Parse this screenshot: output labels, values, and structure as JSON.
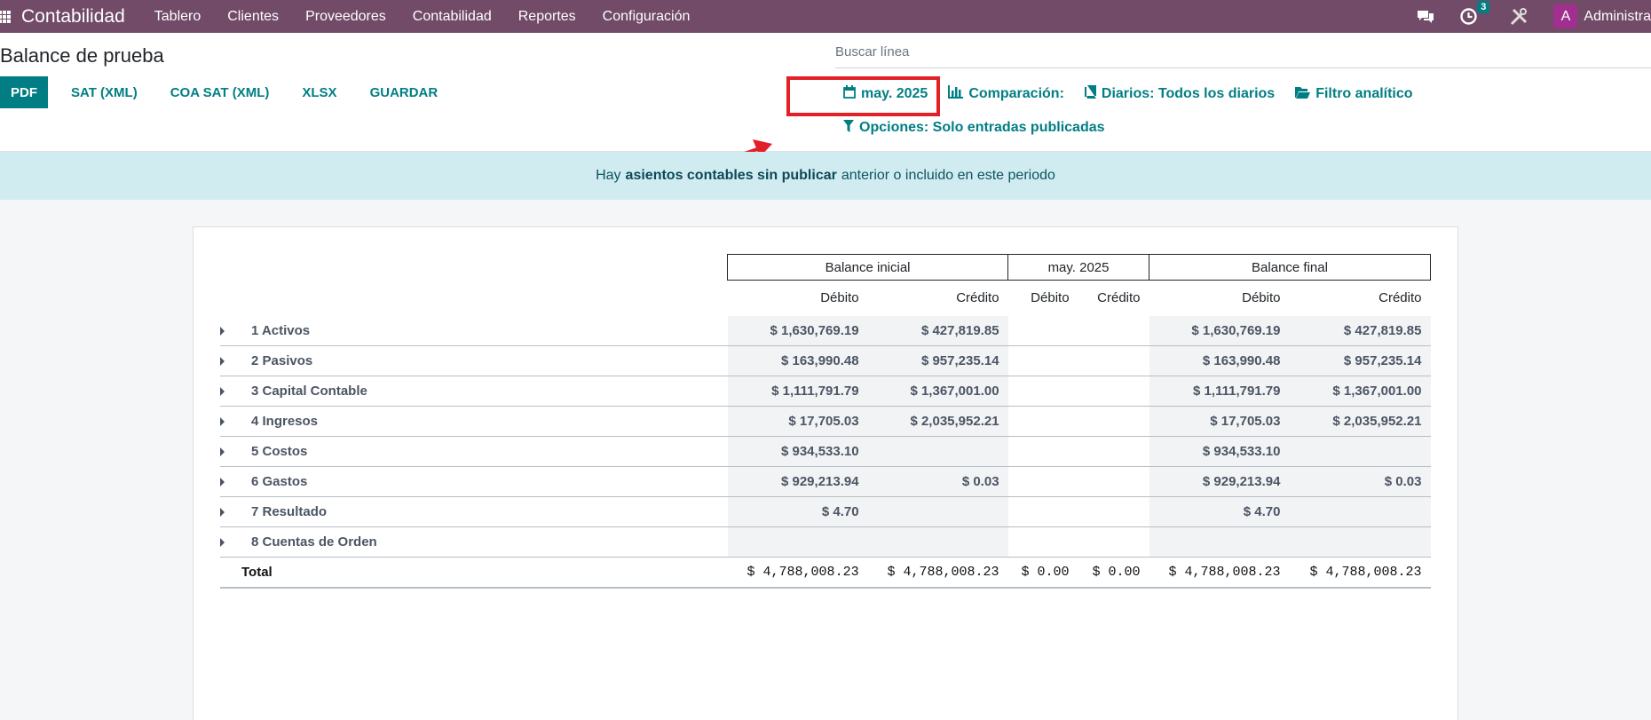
{
  "navbar": {
    "brand": "Contabilidad",
    "items": [
      "Tablero",
      "Clientes",
      "Proveedores",
      "Contabilidad",
      "Reportes",
      "Configuración"
    ],
    "activity_badge": "3",
    "avatar_letter": "A",
    "user": "Administra"
  },
  "control": {
    "title": "Balance de prueba",
    "search_placeholder": "Buscar línea",
    "buttons": {
      "pdf": "PDF",
      "sat_xml": "SAT (XML)",
      "coa_sat_xml": "COA SAT (XML)",
      "xlsx": "XLSX",
      "save": "GUARDAR"
    },
    "filters": {
      "period": "may. 2025",
      "comparison": "Comparación:",
      "journals": "Diarios: Todos los diarios",
      "analytic": "Filtro analítico",
      "options": "Opciones: Solo entradas publicadas"
    }
  },
  "alert": {
    "prefix": "Hay",
    "link": "asientos contables sin publicar",
    "suffix": "anterior o incluido en este periodo"
  },
  "report": {
    "groups": [
      "Balance inicial",
      "may. 2025",
      "Balance final"
    ],
    "subcols": [
      "Débito",
      "Crédito",
      "Débito",
      "Crédito",
      "Débito",
      "Crédito"
    ],
    "rows": [
      {
        "name": "1 Activos",
        "v": [
          "$ 1,630,769.19",
          "$ 427,819.85",
          "",
          "",
          "$ 1,630,769.19",
          "$ 427,819.85"
        ]
      },
      {
        "name": "2 Pasivos",
        "v": [
          "$ 163,990.48",
          "$ 957,235.14",
          "",
          "",
          "$ 163,990.48",
          "$ 957,235.14"
        ]
      },
      {
        "name": "3 Capital Contable",
        "v": [
          "$ 1,111,791.79",
          "$ 1,367,001.00",
          "",
          "",
          "$ 1,111,791.79",
          "$ 1,367,001.00"
        ]
      },
      {
        "name": "4 Ingresos",
        "v": [
          "$ 17,705.03",
          "$ 2,035,952.21",
          "",
          "",
          "$ 17,705.03",
          "$ 2,035,952.21"
        ]
      },
      {
        "name": "5 Costos",
        "v": [
          "$ 934,533.10",
          "",
          "",
          "",
          "$ 934,533.10",
          ""
        ]
      },
      {
        "name": "6 Gastos",
        "v": [
          "$ 929,213.94",
          "$ 0.03",
          "",
          "",
          "$ 929,213.94",
          "$ 0.03"
        ]
      },
      {
        "name": "7 Resultado",
        "v": [
          "$ 4.70",
          "",
          "",
          "",
          "$ 4.70",
          ""
        ]
      },
      {
        "name": "8 Cuentas de Orden",
        "v": [
          "",
          "",
          "",
          "",
          "",
          ""
        ]
      }
    ],
    "total": {
      "name": "Total",
      "v": [
        "$ 4,788,008.23",
        "$ 4,788,008.23",
        "$ 0.00",
        "$ 0.00",
        "$ 4,788,008.23",
        "$ 4,788,008.23"
      ]
    }
  },
  "colors": {
    "navbar": "#714b67",
    "accent": "#017e84",
    "alert_bg": "#d1ecf1",
    "annotation": "#e32027"
  }
}
